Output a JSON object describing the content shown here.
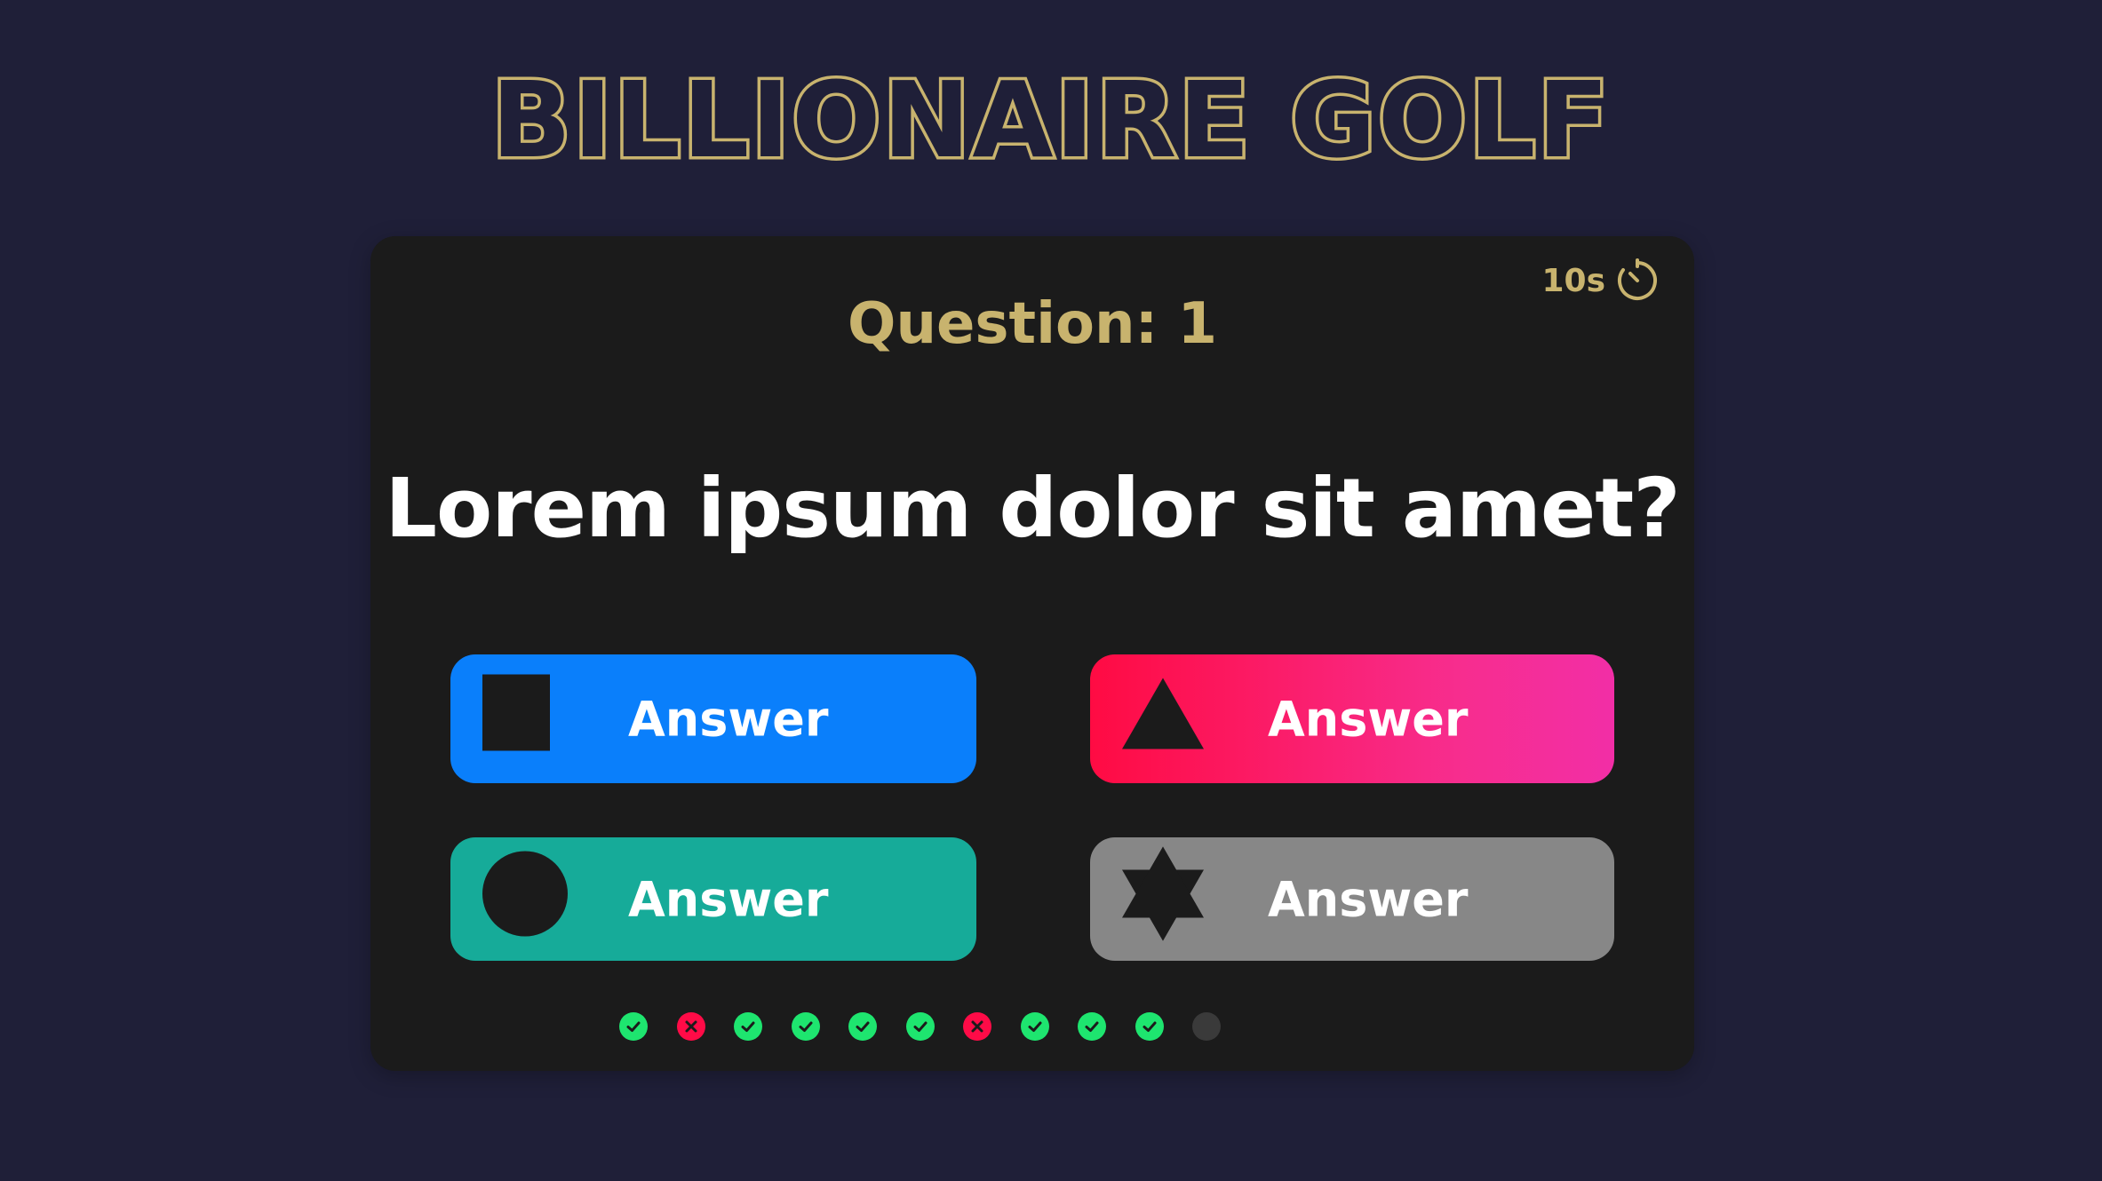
{
  "header": {
    "title": "BILLIONAIRE GOLF"
  },
  "card": {
    "timer": {
      "value": "10s",
      "icon": "stopwatch-icon"
    },
    "question_label": "Question: 1",
    "question_text": "Lorem ipsum dolor sit amet?"
  },
  "answers": [
    {
      "label": "Answer",
      "shape": "square-icon",
      "color": "#0a7ffb"
    },
    {
      "label": "Answer",
      "shape": "triangle-icon",
      "color": "#ff0b43"
    },
    {
      "label": "Answer",
      "shape": "circle-icon",
      "color": "#16ab99"
    },
    {
      "label": "Answer",
      "shape": "star-icon",
      "color": "#878787"
    }
  ],
  "progress": {
    "items": [
      "correct",
      "wrong",
      "correct",
      "correct",
      "correct",
      "correct",
      "wrong",
      "correct",
      "correct",
      "correct",
      "pending"
    ]
  },
  "colors": {
    "background": "#1f1f38",
    "card": "#1b1b1b",
    "accent_gold": "#c8b36e",
    "correct": "#1ee56f",
    "wrong": "#ff0b47",
    "pending": "#3a3a3a"
  }
}
